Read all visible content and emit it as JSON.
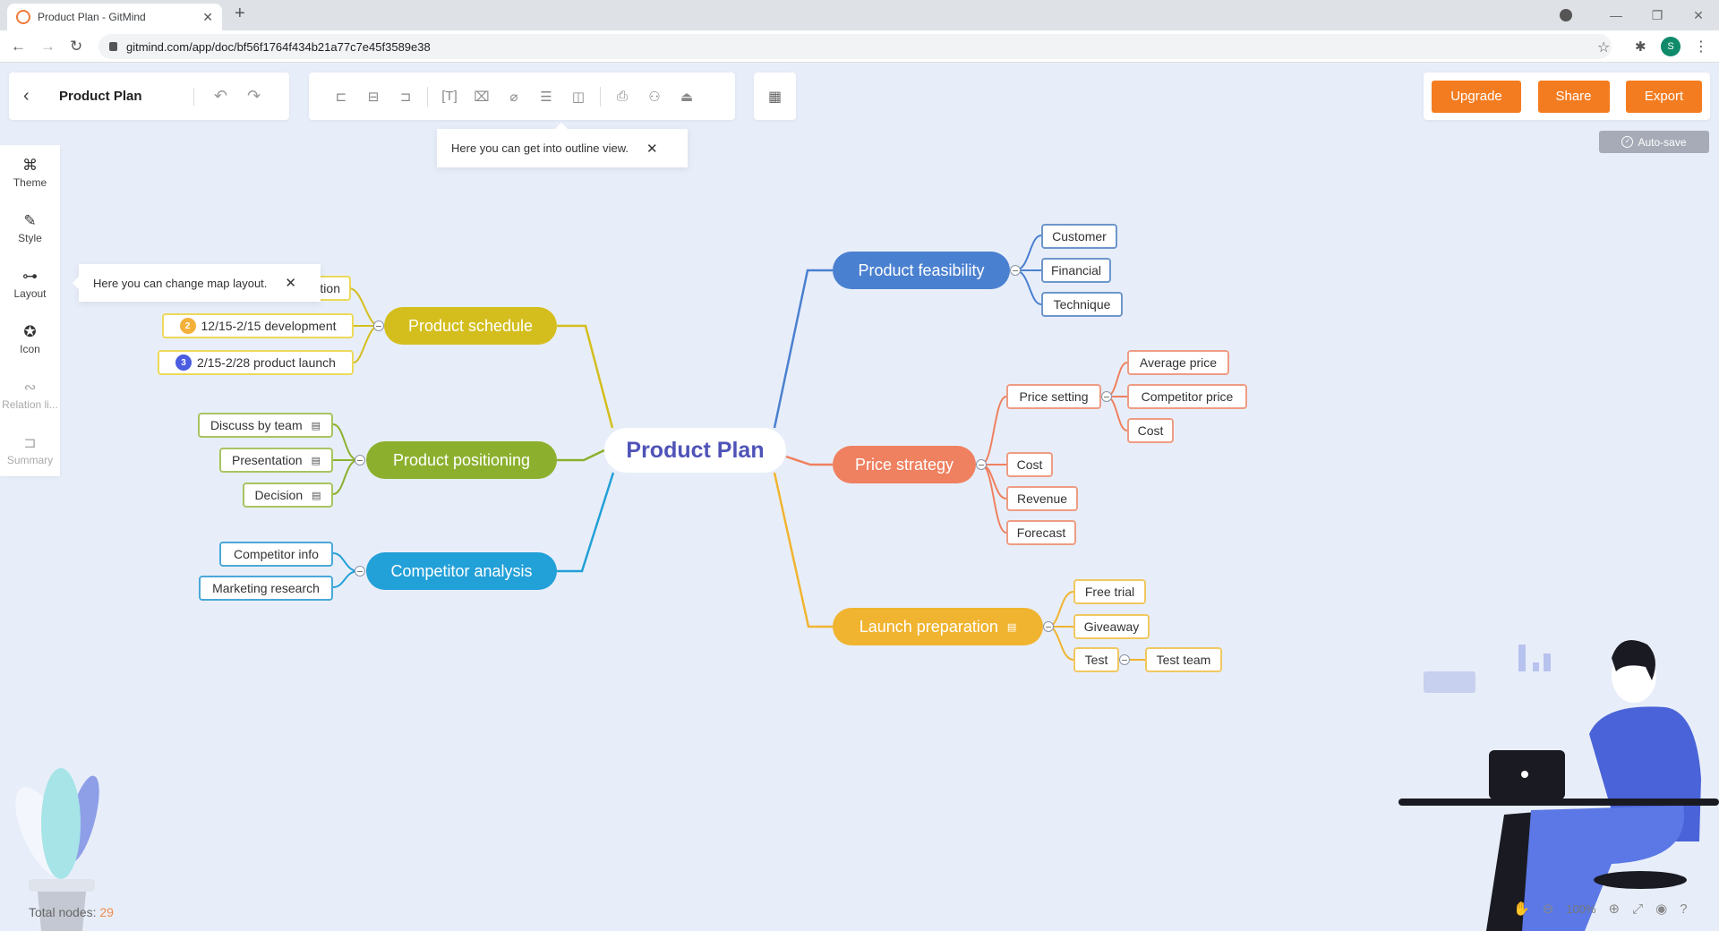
{
  "browser": {
    "tab_title": "Product Plan - GitMind",
    "url": "gitmind.com/app/doc/bf56f1764f434b21a77c7e45f3589e38",
    "profile_initial": "S"
  },
  "header": {
    "doc_title": "Product Plan",
    "buttons": {
      "upgrade": "Upgrade",
      "share": "Share",
      "export": "Export"
    },
    "autosave": "Auto-save",
    "brand_color": "#f47c20"
  },
  "tooltips": {
    "outline": "Here you can get into outline view.",
    "layout": "Here you can change map layout."
  },
  "sidebar": {
    "items": [
      {
        "label": "Theme",
        "icon": "theme-icon"
      },
      {
        "label": "Style",
        "icon": "style-icon"
      },
      {
        "label": "Layout",
        "icon": "layout-icon"
      },
      {
        "label": "Icon",
        "icon": "star-icon"
      },
      {
        "label": "Relation li...",
        "icon": "relation-line-icon",
        "disabled": true
      },
      {
        "label": "Summary",
        "icon": "summary-icon",
        "disabled": true
      }
    ]
  },
  "mindmap": {
    "root": "Product Plan",
    "branches": {
      "schedule": {
        "label": "Product schedule",
        "color": "#d4be1e",
        "children": [
          "...tion",
          "12/15-2/15 development",
          "2/15-2/28 product launch"
        ],
        "badges": [
          "",
          "2",
          "3"
        ]
      },
      "positioning": {
        "label": "Product positioning",
        "color": "#8cb02e",
        "children": [
          "Discuss by team",
          "Presentation",
          "Decision"
        ]
      },
      "competitor": {
        "label": "Competitor analysis",
        "color": "#22a0d8",
        "children": [
          "Competitor info",
          "Marketing research"
        ]
      },
      "feasibility": {
        "label": "Product feasibility",
        "color": "#4a80d0",
        "children": [
          "Customer",
          "Financial",
          "Technique"
        ]
      },
      "price": {
        "label": "Price strategy",
        "color": "#ef8060",
        "children": [
          "Price setting",
          "Cost",
          "Revenue",
          "Forecast"
        ],
        "price_setting_children": [
          "Average price",
          "Competitor price",
          "Cost"
        ]
      },
      "launch": {
        "label": "Launch preparation",
        "color": "#f0b430",
        "children": [
          "Free trial",
          "Giveaway",
          "Test"
        ],
        "test_children": [
          "Test team"
        ]
      }
    }
  },
  "footer": {
    "total_nodes_label": "Total nodes: ",
    "total_nodes": "29",
    "zoom": "100%"
  }
}
